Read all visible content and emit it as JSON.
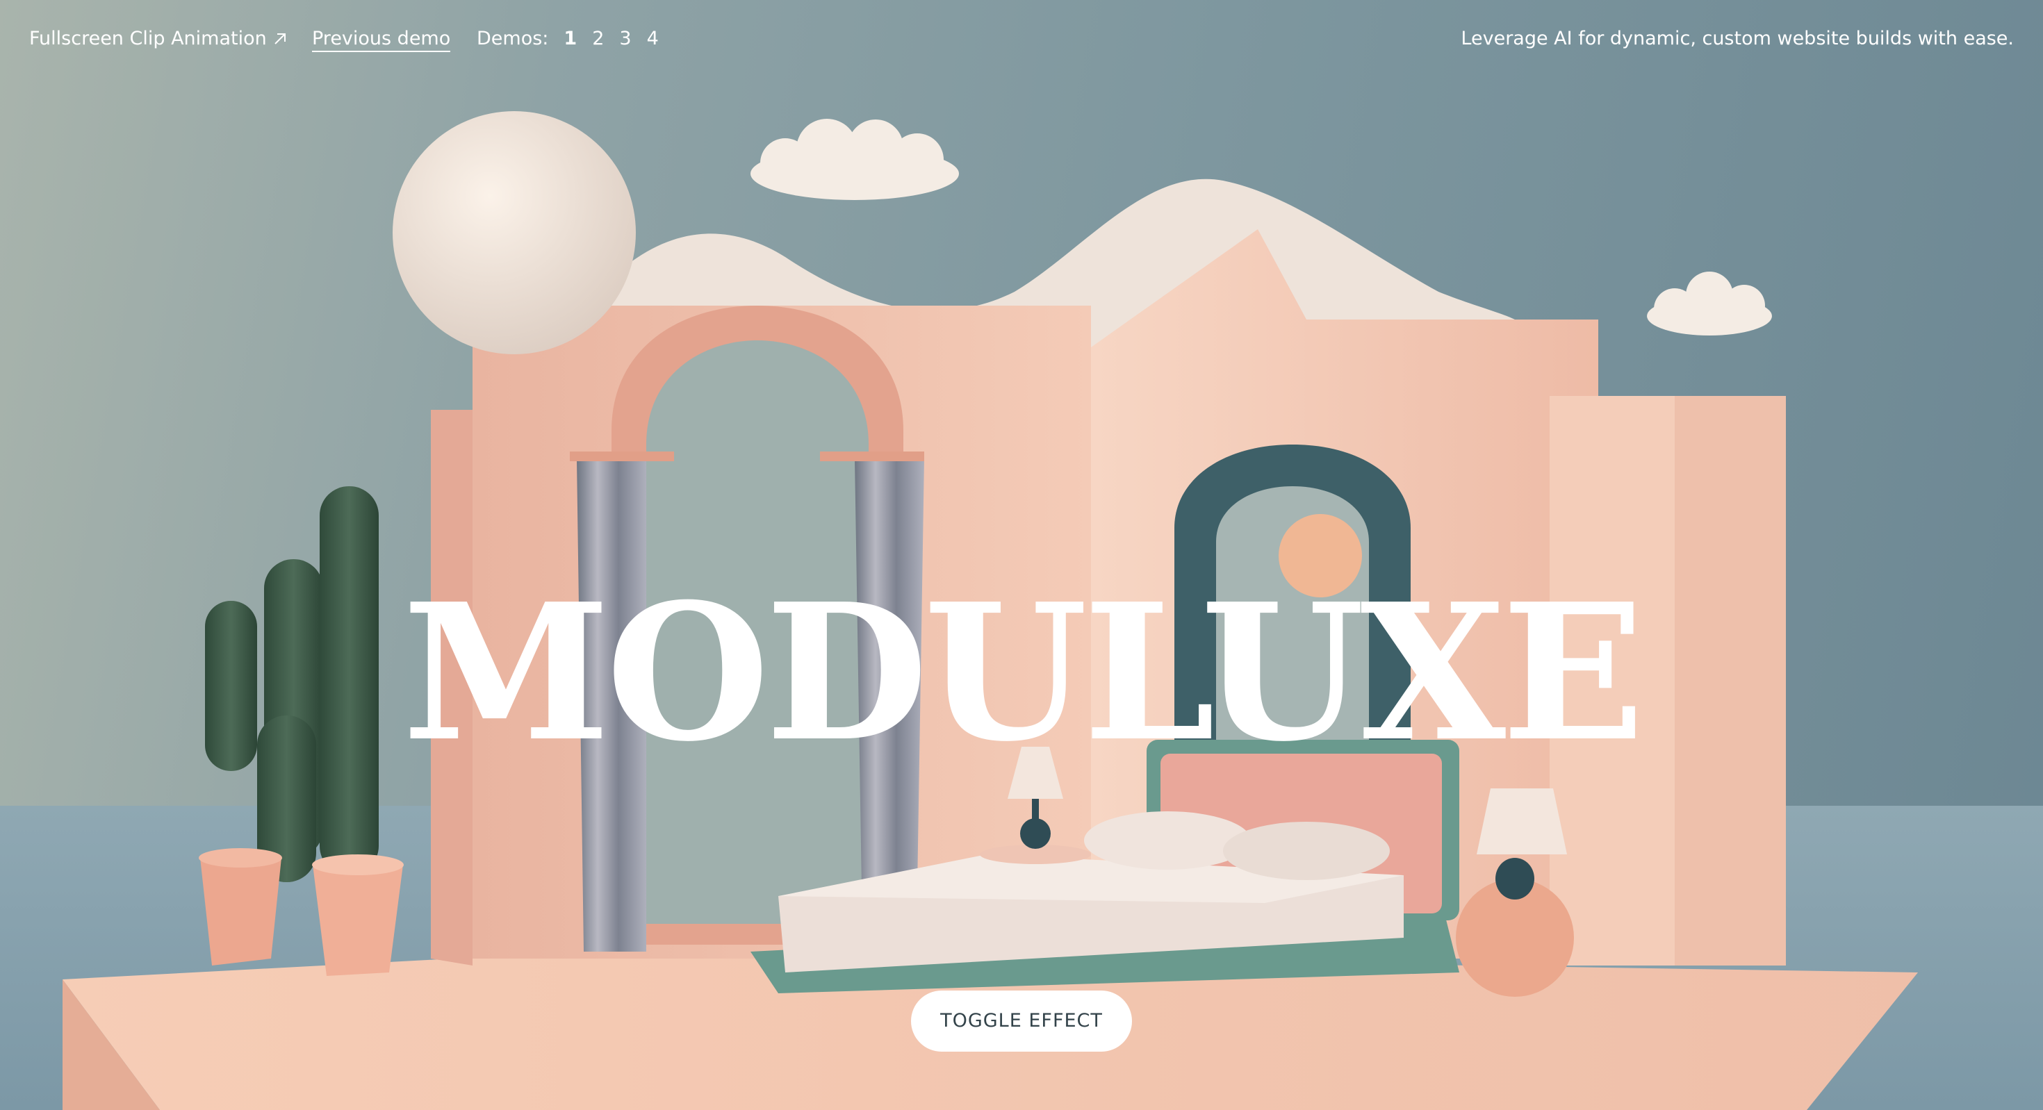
{
  "topbar": {
    "title_link": "Fullscreen Clip Animation",
    "title_link_icon": "arrow-up-right-icon",
    "previous_demo": "Previous demo",
    "demos_label": "Demos:",
    "demos": [
      "1",
      "2",
      "3",
      "4"
    ],
    "active_demo": "1",
    "tagline": "Leverage AI for dynamic, custom website builds with ease."
  },
  "hero": {
    "title": "MODULUXE"
  },
  "toggle_button": {
    "label": "TOGGLE EFFECT"
  },
  "colors": {
    "text": "#ffffff",
    "wall_pink": "#f3c9b4",
    "wall_shadow": "#e6ad9c",
    "cactus_green": "#3e5a48",
    "bed_frame_teal": "#6a9a8e",
    "button_text": "#33434a"
  }
}
